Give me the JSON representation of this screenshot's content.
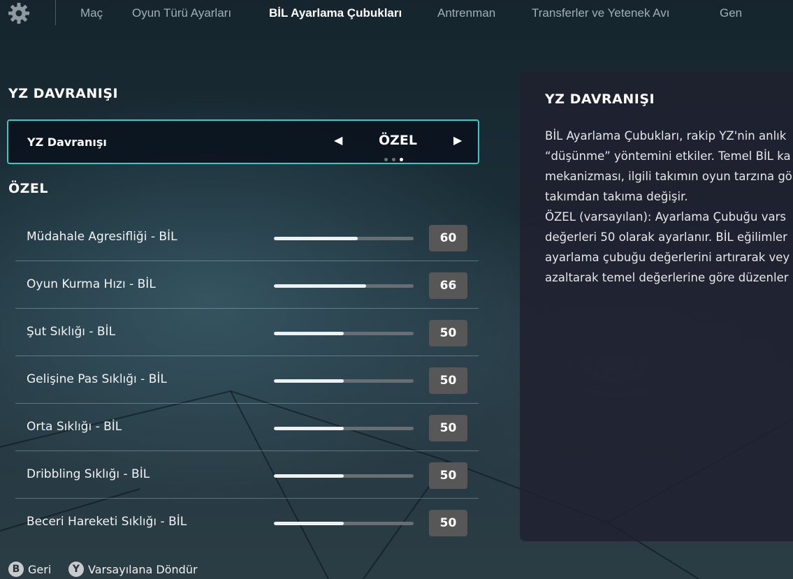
{
  "nav": {
    "settings_icon": "gear-icon",
    "tabs": [
      {
        "label": "Maç",
        "active": false
      },
      {
        "label": "Oyun Türü Ayarları",
        "active": false
      },
      {
        "label": "BİL Ayarlama Çubukları",
        "active": true
      },
      {
        "label": "Antrenman",
        "active": false
      },
      {
        "label": "Transferler ve Yetenek Avı",
        "active": false
      },
      {
        "label": "Gen",
        "active": false
      }
    ]
  },
  "left": {
    "section_title": "YZ DAVRANIŞI",
    "behavior": {
      "label": "YZ Davranışı",
      "value": "ÖZEL",
      "prev_icon": "triangle-left-icon",
      "next_icon": "triangle-right-icon",
      "page_count": 3,
      "current_page": 3
    },
    "custom_title": "ÖZEL",
    "sliders": [
      {
        "label": "Müdahale Agresifliği - BİL",
        "value": "60",
        "level": 0.6
      },
      {
        "label": "Oyun Kurma Hızı - BİL",
        "value": "66",
        "level": 0.66
      },
      {
        "label": "Şut Sıklığı - BİL",
        "value": "50",
        "level": 0.5
      },
      {
        "label": "Gelişine Pas Sıklığı - BİL",
        "value": "50",
        "level": 0.5
      },
      {
        "label": "Orta Sıklığı - BİL",
        "value": "50",
        "level": 0.5
      },
      {
        "label": "Dribbling Sıklığı - BİL",
        "value": "50",
        "level": 0.5
      },
      {
        "label": "Beceri Hareketi Sıklığı - BİL",
        "value": "50",
        "level": 0.5
      }
    ]
  },
  "info": {
    "title": "YZ DAVRANIŞI",
    "lines": [
      "BİL Ayarlama Çubukları, rakip YZ'nin anlık",
      "“düşünme” yöntemini etkiler. Temel BİL ka",
      "mekanizması, ilgili takımın oyun tarzına gö",
      "takımdan takıma değişir.",
      "ÖZEL (varsayılan): Ayarlama Çubuğu vars",
      "değerleri 50 olarak ayarlanır. BİL eğilimler",
      "ayarlama çubuğu değerlerini artırarak vey",
      "azaltarak temel değerlerine göre düzenler"
    ]
  },
  "footer": {
    "back": {
      "button": "B",
      "label": "Geri"
    },
    "reset": {
      "button": "Y",
      "label": "Varsayılana Döndür"
    }
  },
  "colors": {
    "accent": "#3fc6c2",
    "value_box": "#575757",
    "track": "#6a6e70",
    "fill": "#f0f0ee"
  }
}
